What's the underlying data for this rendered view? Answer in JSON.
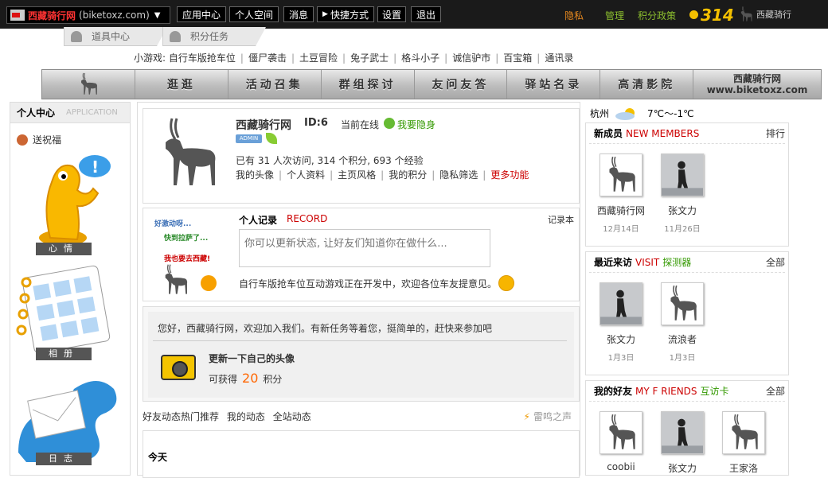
{
  "topbar": {
    "site_name": "西藏骑行网",
    "site_url": "(biketoxz.com)",
    "buttons": [
      "应用中心",
      "个人空间",
      "消息",
      "快捷方式",
      "设置",
      "退出"
    ],
    "links": {
      "privacy": "隐私",
      "manage": "管理",
      "points_policy": "积分政策"
    },
    "points": "314",
    "logo_text": "西藏骑行"
  },
  "subtabs": [
    "道具中心",
    "积分任务"
  ],
  "games": {
    "label": "小游戏:",
    "items": [
      "自行车版抢车位",
      "僵尸袭击",
      "土豆冒险",
      "兔子武士",
      "格斗小子",
      "诚信驴市",
      "百宝箱",
      "通讯录"
    ]
  },
  "mainnav": {
    "items": [
      "逛逛",
      "活动召集",
      "群组探讨",
      "友问友答",
      "驿站名录",
      "高清影院"
    ],
    "brand": "西藏骑行网",
    "brand_url": "www.biketoxz.com"
  },
  "leftcol": {
    "title": "个人中心",
    "title_en": "APPLICATION",
    "gift": "送祝福",
    "apps": [
      "心情",
      "相册",
      "日志"
    ]
  },
  "profile": {
    "name": "西藏骑行网",
    "id": "ID:6",
    "online": "当前在线",
    "hide": "我要隐身",
    "admin_badge": "ADMIN",
    "stats": "已有 31 人次访问, 314 个积分, 693 个经验",
    "links": [
      "我的头像",
      "个人资料",
      "主页风格",
      "我的积分",
      "隐私筛选"
    ],
    "more": "更多功能"
  },
  "record": {
    "title": "个人记录",
    "title_en": "RECORD",
    "book": "记录本",
    "placeholder": "你可以更新状态, 让好友们知道你在做什么...",
    "note": "自行车版抢车位互动游戏正在开发中，欢迎各位车友提意见。",
    "hand_lines": [
      "好激动呀...",
      "快到拉萨了...",
      "我也要去西藏!"
    ]
  },
  "task": {
    "welcome": "您好，西藏骑行网，欢迎加入我们。有新任务等着您，挺简单的，赶快来参加吧",
    "title": "更新一下自己的头像",
    "reward_prefix": "可获得",
    "reward_value": "20",
    "reward_unit": "积分"
  },
  "feed": {
    "tabs": [
      "好友动态热门推荐",
      "我的动态",
      "全站动态"
    ],
    "thunder": "雷鸣之声",
    "today": "今天"
  },
  "weather": {
    "city": "杭州",
    "temp": "7℃～-1℃"
  },
  "new_members": {
    "title": "新成员",
    "title_en": "NEW MEMBERS",
    "more": "排行",
    "items": [
      {
        "name": "西藏骑行网",
        "date": "12月14日"
      },
      {
        "name": "张文力",
        "date": "11月26日"
      }
    ]
  },
  "visitors": {
    "title": "最近来访",
    "title_en": "VISIT",
    "tag": "探测器",
    "more": "全部",
    "items": [
      {
        "name": "张文力",
        "date": "1月3日"
      },
      {
        "name": "流浪者",
        "date": "1月3日"
      }
    ]
  },
  "friends": {
    "title": "我的好友",
    "title_en": "MY F RIENDS",
    "tag": "互访卡",
    "more": "全部",
    "items": [
      {
        "name": "coobii"
      },
      {
        "name": "张文力"
      },
      {
        "name": "王家洛"
      }
    ]
  },
  "colors": {
    "accent_red": "#cc0000",
    "accent_green": "#339900",
    "points_gold": "#f4c000"
  }
}
